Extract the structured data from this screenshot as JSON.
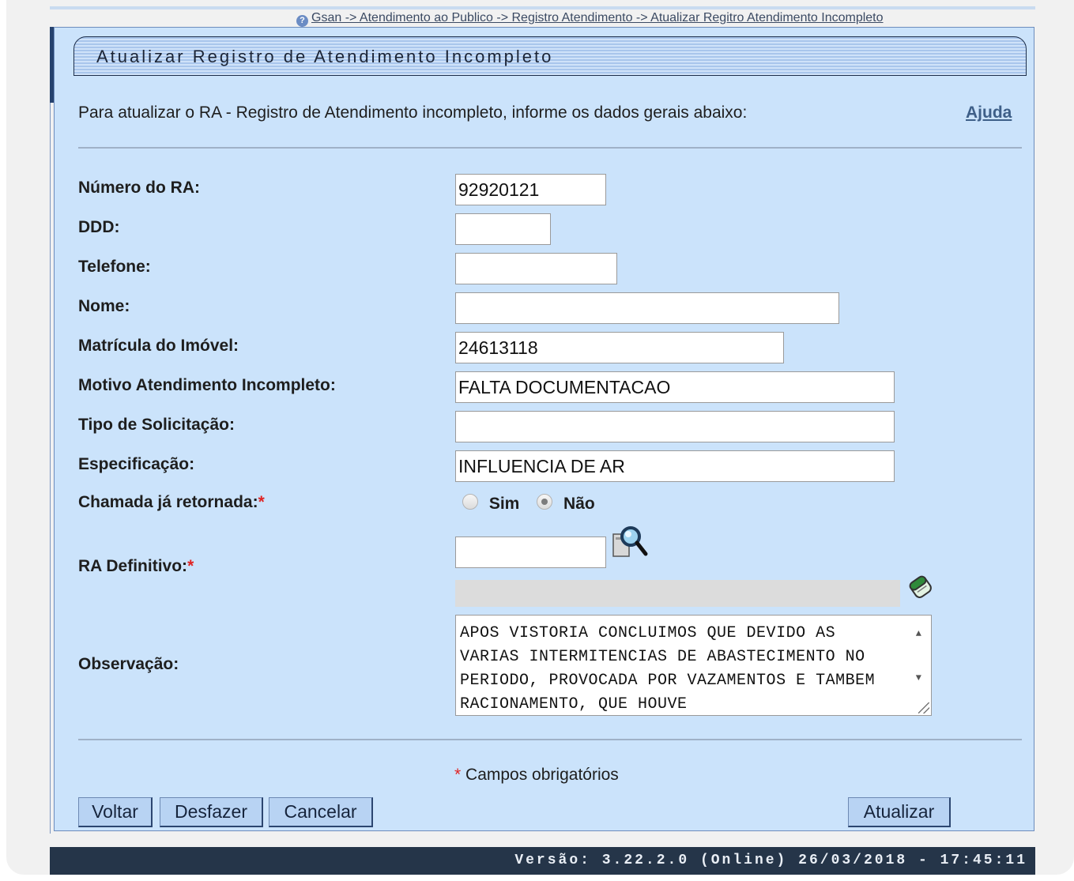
{
  "breadcrumb": "Gsan -> Atendimento ao Publico -> Registro Atendimento -> Atualizar Regitro Atendimento Incompleto",
  "title": "Atualizar Registro de Atendimento Incompleto",
  "intro": "Para atualizar o RA - Registro de Atendimento incompleto, informe os dados gerais abaixo:",
  "help_link": "Ajuda",
  "fields": {
    "numero_ra": {
      "label": "Número do RA:",
      "value": "92920121"
    },
    "ddd": {
      "label": "DDD:",
      "value": ""
    },
    "telefone": {
      "label": "Telefone:",
      "value": ""
    },
    "nome": {
      "label": "Nome:",
      "value": ""
    },
    "matricula": {
      "label": "Matrícula do Imóvel:",
      "value": "24613118"
    },
    "motivo": {
      "label": "Motivo Atendimento Incompleto:",
      "value": "FALTA DOCUMENTACAO"
    },
    "tipo_solicitacao": {
      "label": "Tipo de Solicitação:",
      "value": ""
    },
    "especificacao": {
      "label": "Especificação:",
      "value": "INFLUENCIA DE AR"
    },
    "chamada_retornada": {
      "label": "Chamada já retornada:",
      "options": [
        "Sim",
        "Não"
      ],
      "selected": "Não"
    },
    "ra_definitivo": {
      "label": "RA Definitivo:",
      "value": ""
    },
    "observacao": {
      "label": "Observação:",
      "value": "APOS VISTORIA CONCLUIMOS QUE DEVIDO AS VARIAS INTERMITENCIAS DE ABASTECIMENTO NO PERIODO, PROVOCADA POR VAZAMENTOS E TAMBEM RACIONAMENTO, QUE HOUVE"
    }
  },
  "required_marker": "*",
  "required_note": "Campos obrigatórios",
  "buttons": {
    "voltar": "Voltar",
    "desfazer": "Desfazer",
    "cancelar": "Cancelar",
    "atualizar": "Atualizar"
  },
  "footer": {
    "version": "Versão: 3.22.2.0 (Online) 26/03/2018 - 17:45:11"
  },
  "icons": {
    "help": "help-icon",
    "search": "search-icon",
    "erase": "eraser-icon"
  },
  "colors": {
    "panel_bg": "#cbe3fb",
    "footer_bg": "#253549",
    "button_bg": "#b8d3f3",
    "required": "#e02424"
  }
}
